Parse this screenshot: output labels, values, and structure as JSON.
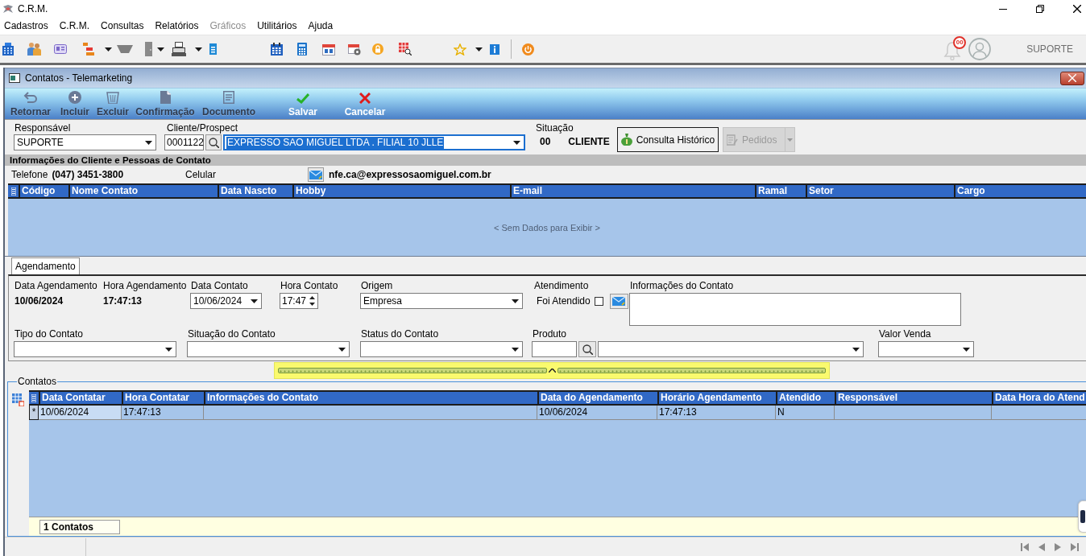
{
  "app": {
    "title": "C.R.M."
  },
  "menu": [
    {
      "label": "Cadastros",
      "disabled": false
    },
    {
      "label": "C.R.M.",
      "disabled": false
    },
    {
      "label": "Consultas",
      "disabled": false
    },
    {
      "label": "Relatórios",
      "disabled": false
    },
    {
      "label": "Gráficos",
      "disabled": true
    },
    {
      "label": "Utilitários",
      "disabled": false
    },
    {
      "label": "Ajuda",
      "disabled": false
    }
  ],
  "user_area": {
    "notification_count": "00",
    "user_name": "SUPORTE"
  },
  "child_window": {
    "title": "Contatos - Telemarketing"
  },
  "child_toolbar": [
    {
      "label": "Retornar",
      "disabled": true
    },
    {
      "label": "Incluir",
      "disabled": true
    },
    {
      "label": "Excluir",
      "disabled": true
    },
    {
      "label": "Confirmação",
      "disabled": true
    },
    {
      "label": "Documento",
      "disabled": true
    },
    {
      "label": "Salvar",
      "disabled": false
    },
    {
      "label": "Cancelar",
      "disabled": false
    }
  ],
  "header": {
    "responsavel": {
      "label": "Responsável",
      "value": "SUPORTE"
    },
    "cliente": {
      "label": "Cliente/Prospect",
      "code": "0001122",
      "value": "EXPRESSO SAO MIGUEL LTDA . FILIAL 10 JLLE",
      "focused": true
    },
    "situacao": {
      "label": "Situação",
      "code": "00",
      "value": "CLIENTE"
    },
    "buttons": [
      {
        "label": "Consulta Histórico",
        "kind": "plain",
        "disabled": false
      },
      {
        "label": "Pedidos",
        "kind": "split",
        "disabled": true
      }
    ]
  },
  "client_info": {
    "title": "Informações do Cliente e Pessoas de Contato",
    "phone_label": "Telefone",
    "phone": "(047) 3451-3800",
    "mobile_label": "Celular",
    "email": "nfe.ca@expressosaomiguel.com.br"
  },
  "contacts_table": {
    "columns": [
      "Código",
      "Nome Contato",
      "Data Nascto",
      "Hobby",
      "E-mail",
      "Ramal",
      "Setor",
      "Cargo"
    ],
    "empty_text": "< Sem Dados para Exibir >"
  },
  "tabs": [
    {
      "label": "Agendamento",
      "selected": true
    }
  ],
  "schedule": {
    "rows": [
      {
        "fields": [
          {
            "kind": "readonly",
            "label": "Data Agendamento",
            "value": "10/06/2024"
          },
          {
            "kind": "readonly",
            "label": "Hora Agendamento",
            "value": "17:47:13"
          },
          {
            "kind": "date",
            "label": "Data Contato",
            "value": "10/06/2024"
          },
          {
            "kind": "time",
            "label": "Hora Contato",
            "value": "17:47"
          },
          {
            "kind": "combo",
            "label": "Origem",
            "value": "Empresa"
          },
          {
            "kind": "checkbox",
            "label": "Atendimento",
            "option": "Foi Atendido",
            "checked": false
          },
          {
            "kind": "memo",
            "label": "Informações do Contato"
          }
        ]
      },
      {
        "fields": [
          {
            "kind": "combo",
            "label": "Tipo do Contato"
          },
          {
            "kind": "combo",
            "label": "Situação do Contato"
          },
          {
            "kind": "combo",
            "label": "Status do Contato"
          },
          {
            "kind": "lookup",
            "label": "Produto"
          },
          {
            "kind": "combo",
            "label": "Valor Venda"
          }
        ]
      }
    ]
  },
  "contatos": {
    "title": "Contatos",
    "columns": [
      "Data Contatar",
      "Hora Contatar",
      "Informações do Contato",
      "Data do Agendamento",
      "Horário Agendamento",
      "Atendido",
      "Responsável",
      "Data Hora do Atend"
    ],
    "rows": [
      {
        "indicator": "*",
        "cells": [
          {
            "text": "10/06/2024",
            "focused": true
          },
          {
            "text": "17:47:13",
            "focused": false
          },
          {
            "focused": false
          },
          {
            "text": "10/06/2024",
            "focused": false
          },
          {
            "text": "17:47:13",
            "focused": false
          },
          {
            "text": "N",
            "focused": false
          },
          {
            "focused": false
          },
          {
            "focused": false
          }
        ]
      }
    ],
    "footer": "1 Contatos"
  }
}
